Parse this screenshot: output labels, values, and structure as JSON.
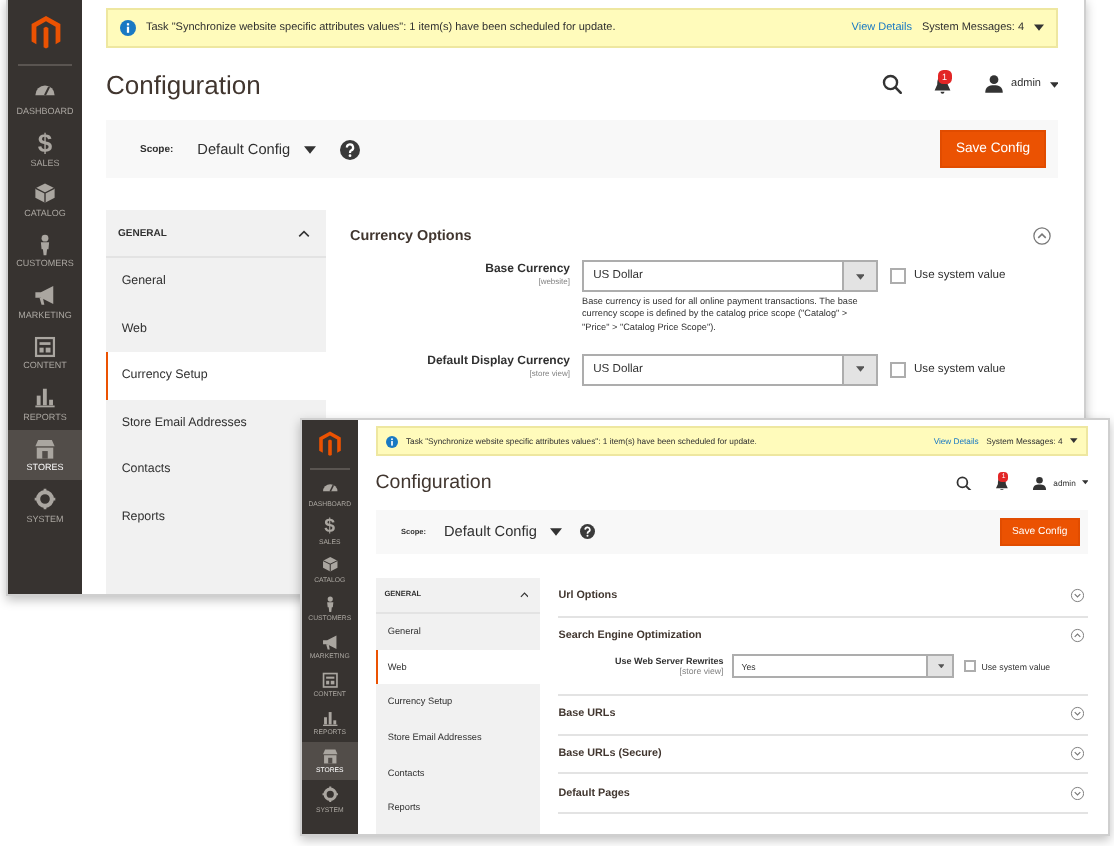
{
  "windows": [
    {
      "notice": {
        "text": "Task \"Synchronize website specific attributes values\": 1 item(s) have been scheduled for update.",
        "link": "View Details",
        "messages": "System Messages: 4"
      },
      "nav": [
        {
          "kind": "gauge",
          "label": "DASHBOARD",
          "selected": false
        },
        {
          "kind": "glyph",
          "glyph": "$",
          "label": "SALES",
          "selected": false
        },
        {
          "kind": "cube",
          "label": "CATALOG",
          "selected": false
        },
        {
          "kind": "person",
          "label": "CUSTOMERS",
          "selected": false
        },
        {
          "kind": "megaphone",
          "label": "MARKETING",
          "selected": false
        },
        {
          "kind": "layout",
          "label": "CONTENT",
          "selected": false
        },
        {
          "kind": "bars",
          "label": "REPORTS",
          "selected": false
        },
        {
          "kind": "store",
          "label": "STORES",
          "selected": true
        },
        {
          "kind": "gear",
          "label": "SYSTEM",
          "selected": false
        }
      ],
      "title": "Configuration",
      "notification_count": "1",
      "user": "admin",
      "scope": {
        "label": "Scope:",
        "value": "Default Config"
      },
      "save_button": "Save Config",
      "tab_group": "GENERAL",
      "tabs": [
        {
          "label": "General",
          "selected": false
        },
        {
          "label": "Web",
          "selected": false
        },
        {
          "label": "Currency Setup",
          "selected": true
        },
        {
          "label": "Store Email Addresses",
          "selected": false
        },
        {
          "label": "Contacts",
          "selected": false
        },
        {
          "label": "Reports",
          "selected": false
        }
      ],
      "sections": [
        {
          "title": "Currency Options",
          "expanded": true,
          "fields": [
            {
              "label": "Base Currency",
              "scope": "[website]",
              "value": "US Dollar",
              "system_label": "Use system value",
              "checked": false,
              "note": "Base currency is used for all online payment transactions. The base currency scope is defined by the catalog price scope (\"Catalog\" > \"Price\" > \"Catalog Price Scope\")."
            },
            {
              "label": "Default Display Currency",
              "scope": "[store view]",
              "value": "US Dollar",
              "system_label": "Use system value",
              "checked": false
            }
          ]
        }
      ]
    },
    {
      "notice": {
        "text": "Task \"Synchronize website specific attributes values\": 1 item(s) have been scheduled for update.",
        "link": "View Details",
        "messages": "System Messages: 4"
      },
      "nav": [
        {
          "kind": "gauge",
          "label": "DASHBOARD",
          "selected": false
        },
        {
          "kind": "glyph",
          "glyph": "$",
          "label": "SALES",
          "selected": false
        },
        {
          "kind": "cube",
          "label": "CATALOG",
          "selected": false
        },
        {
          "kind": "person",
          "label": "CUSTOMERS",
          "selected": false
        },
        {
          "kind": "megaphone",
          "label": "MARKETING",
          "selected": false
        },
        {
          "kind": "layout",
          "label": "CONTENT",
          "selected": false
        },
        {
          "kind": "bars",
          "label": "REPORTS",
          "selected": false
        },
        {
          "kind": "store",
          "label": "STORES",
          "selected": true
        },
        {
          "kind": "gear",
          "label": "SYSTEM",
          "selected": false
        }
      ],
      "title": "Configuration",
      "notification_count": "1",
      "user": "admin",
      "scope": {
        "label": "Scope:",
        "value": "Default Config"
      },
      "save_button": "Save Config",
      "tab_group": "GENERAL",
      "tabs": [
        {
          "label": "General",
          "selected": false
        },
        {
          "label": "Web",
          "selected": true
        },
        {
          "label": "Currency Setup",
          "selected": false
        },
        {
          "label": "Store Email Addresses",
          "selected": false
        },
        {
          "label": "Contacts",
          "selected": false
        },
        {
          "label": "Reports",
          "selected": false
        }
      ],
      "sections": [
        {
          "title": "Url Options",
          "expanded": false
        },
        {
          "title": "Search Engine Optimization",
          "expanded": true,
          "fields": [
            {
              "label": "Use Web Server Rewrites",
              "scope": "[store view]",
              "value": "Yes",
              "system_label": "Use system value",
              "checked": false
            }
          ]
        },
        {
          "title": "Base URLs",
          "expanded": false
        },
        {
          "title": "Base URLs (Secure)",
          "expanded": false
        },
        {
          "title": "Default Pages",
          "expanded": false
        }
      ]
    }
  ]
}
